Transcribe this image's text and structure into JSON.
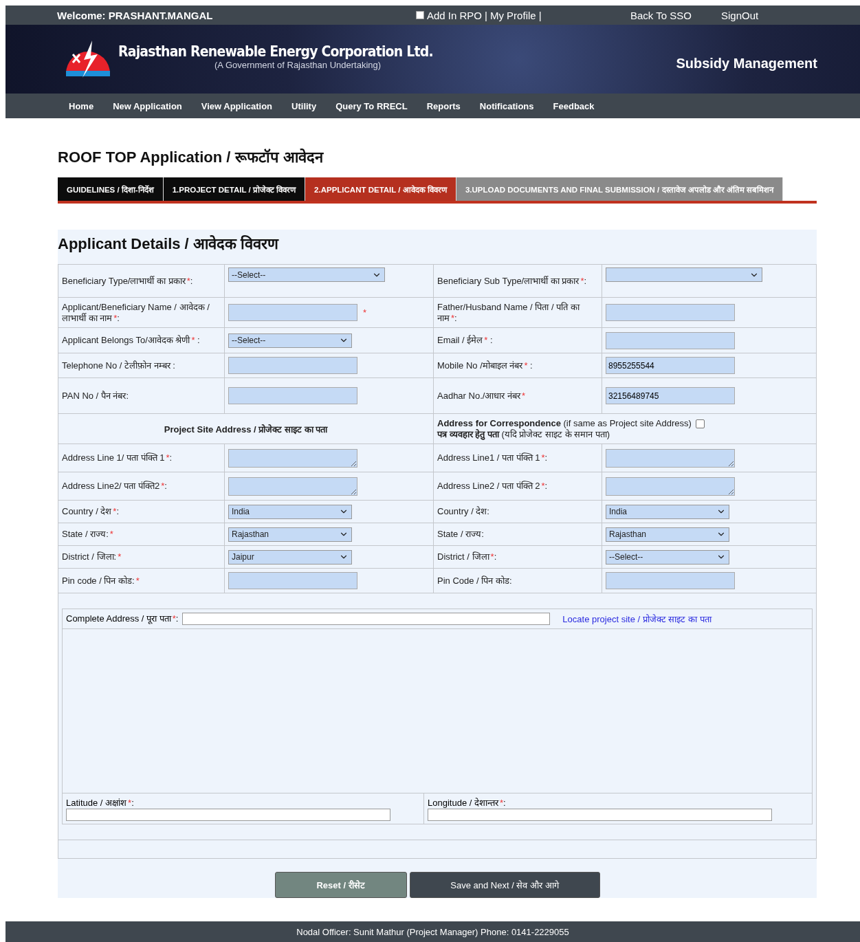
{
  "user_bar": {
    "welcome": "Welcome: PRASHANT.MANGAL",
    "rpo": {
      "label": "Add In RPO",
      "checked": false
    },
    "separators": [
      "|",
      "|"
    ],
    "profile": "My Profile",
    "links": [
      "Back To SSO",
      "SignOut"
    ]
  },
  "brand": {
    "name": "Rajasthan Renewable Energy Corporation Ltd.",
    "tagline": "(A Government of Rajasthan Undertaking)",
    "module": "Subsidy Management"
  },
  "nav": [
    "Home",
    "New Application",
    "View Application",
    "Utility",
    "Query To RRECL",
    "Reports",
    "Notifications",
    "Feedback"
  ],
  "page_title": "ROOF TOP Application / रूफटॉप आवेदन",
  "tabs": [
    {
      "label": "GUIDELINES / दिशा-निर्देश",
      "selected": false,
      "disabled": false
    },
    {
      "label": "1.PROJECT DETAIL / प्रोजेक्ट विवरण",
      "selected": false,
      "disabled": false
    },
    {
      "label": "2.APPLICANT DETAIL / आवेदक विवरण",
      "selected": true,
      "disabled": false
    },
    {
      "label": "3.UPLOAD DOCUMENTS AND FINAL SUBMISSION / दस्तावेज अपलोड और अंतिम सबमिशन",
      "selected": false,
      "disabled": true
    }
  ],
  "section_title": "Applicant Details / आवेदक विवरण",
  "rows": [
    [
      {
        "label": "Beneficiary Type/लाभार्थी का प्रकार",
        "mark": "*",
        "suffix": ":",
        "kind": "select",
        "value": "--Select--",
        "wide": true
      },
      {
        "label": "Beneficiary Sub Type/लाभार्थी का प्रकार",
        "mark": "*",
        "suffix": ":",
        "kind": "select",
        "wide": true
      }
    ],
    [
      {
        "label": "Applicant/Beneficiary Name / आवेदक / लाभार्थी का नाम",
        "mark": "*",
        "suffix": ":",
        "kind": "input",
        "after_mark": "*"
      },
      {
        "label": "Father/Husband Name / पिता / पति का नाम",
        "mark": "*",
        "suffix": ":",
        "kind": "input"
      }
    ],
    [
      {
        "label": "Applicant Belongs To/आवेदक श्रेणी",
        "mark": "*",
        "suffix": " :",
        "kind": "select",
        "value": "--Select--"
      },
      {
        "label": "Email / ईमेल",
        "mark": "*",
        "suffix": " :",
        "kind": "input"
      }
    ],
    [
      {
        "label": "Telephone No / टेलीफ़ोन नम्बर  :",
        "kind": "input"
      },
      {
        "label": "Mobile No /मोबाइल नंबर",
        "mark": "*",
        "suffix": " :",
        "kind": "input",
        "value": "8955255544"
      }
    ],
    [
      {
        "label": "PAN No / पैन नंबर:",
        "kind": "input"
      },
      {
        "label": "Aadhar No./आधार नंबर",
        "mark": "*",
        "kind": "input",
        "value": "32156489745"
      }
    ]
  ],
  "address_header": {
    "project_site": "Project Site Address / प्रोजेक्ट साइट का पता",
    "correspondence": "**Address for Correspondence** (if same as Project site Address)",
    "correspondence_hindi": "**पत्र व्यवहार हेतु पता** (यदि प्रोजेक्ट साइट के समान पता)",
    "same_checked": false
  },
  "address_rows": [
    [
      {
        "label": "Address Line 1/ पता पंक्ति 1",
        "mark": "*",
        "suffix": ":",
        "kind": "textarea"
      },
      {
        "label": "Address Line1 / पता पंक्ति 1",
        "mark": "*",
        "suffix": ":",
        "kind": "textarea"
      }
    ],
    [
      {
        "label": "Address Line2/ पता पंक्ति2",
        "mark": "*",
        "suffix": ":",
        "kind": "textarea"
      },
      {
        "label": "Address Line2 / पता पंक्ति 2",
        "mark": "*",
        "suffix": ":",
        "kind": "textarea"
      }
    ],
    [
      {
        "label": "Country / देश",
        "mark": "*",
        "suffix": ":",
        "kind": "select",
        "value": "India"
      },
      {
        "label": "Country  / देश:",
        "kind": "select",
        "value": "India"
      }
    ],
    [
      {
        "label": "State / राज्य:",
        "mark": "*",
        "kind": "select",
        "value": "Rajasthan"
      },
      {
        "label": "State / राज्य:",
        "kind": "select",
        "value": "Rajasthan"
      }
    ],
    [
      {
        "label": "District / जिला:",
        "mark": "*",
        "kind": "select",
        "value": "Jaipur"
      },
      {
        "label": "District / जिला",
        "mark": "*",
        "suffix": ":",
        "kind": "select",
        "value": "--Select--"
      }
    ],
    [
      {
        "label": "Pin code / पिन कोड:",
        "mark": "*",
        "kind": "input"
      },
      {
        "label": "Pin Code / पिन कोड:",
        "kind": "input"
      }
    ]
  ],
  "location": {
    "complete_address": {
      "label": "Complete Address / पूरा पता",
      "mark": "*",
      "suffix": ":"
    },
    "locate_link": "Locate project site / प्रोजेक्ट साइट का पता",
    "latitude": {
      "label": "Latitude / अक्षांश",
      "mark": "*",
      "suffix": ":"
    },
    "longitude": {
      "label": "Longitude / देशान्तर",
      "mark": "*",
      "suffix": ":"
    }
  },
  "buttons": [
    {
      "label": "Reset / रीसेट",
      "kind": "secondary"
    },
    {
      "label": "Save and Next / सेव और आगे",
      "kind": "primary"
    }
  ],
  "footer": "Nodal Officer: Sunit Mathur (Project Manager) Phone: 0141-2229055"
}
